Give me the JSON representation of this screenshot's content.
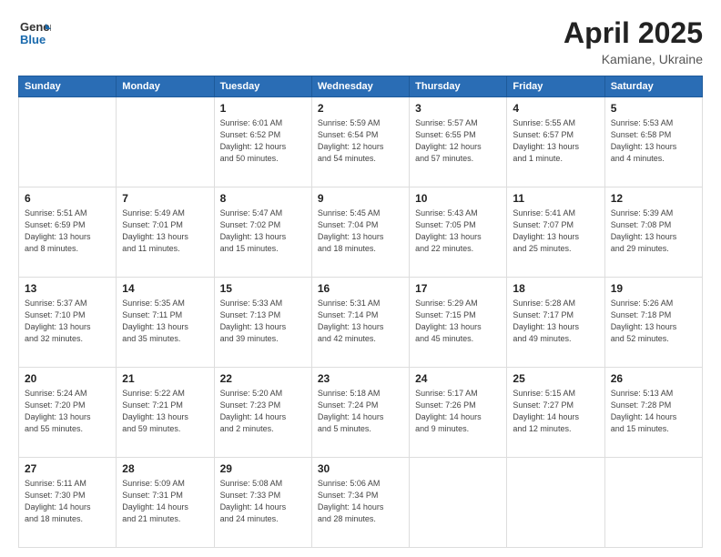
{
  "header": {
    "logo_general": "General",
    "logo_blue": "Blue",
    "title": "April 2025",
    "location": "Kamiane, Ukraine"
  },
  "weekdays": [
    "Sunday",
    "Monday",
    "Tuesday",
    "Wednesday",
    "Thursday",
    "Friday",
    "Saturday"
  ],
  "rows": [
    [
      {
        "day": "",
        "info": ""
      },
      {
        "day": "",
        "info": ""
      },
      {
        "day": "1",
        "info": "Sunrise: 6:01 AM\nSunset: 6:52 PM\nDaylight: 12 hours\nand 50 minutes."
      },
      {
        "day": "2",
        "info": "Sunrise: 5:59 AM\nSunset: 6:54 PM\nDaylight: 12 hours\nand 54 minutes."
      },
      {
        "day": "3",
        "info": "Sunrise: 5:57 AM\nSunset: 6:55 PM\nDaylight: 12 hours\nand 57 minutes."
      },
      {
        "day": "4",
        "info": "Sunrise: 5:55 AM\nSunset: 6:57 PM\nDaylight: 13 hours\nand 1 minute."
      },
      {
        "day": "5",
        "info": "Sunrise: 5:53 AM\nSunset: 6:58 PM\nDaylight: 13 hours\nand 4 minutes."
      }
    ],
    [
      {
        "day": "6",
        "info": "Sunrise: 5:51 AM\nSunset: 6:59 PM\nDaylight: 13 hours\nand 8 minutes."
      },
      {
        "day": "7",
        "info": "Sunrise: 5:49 AM\nSunset: 7:01 PM\nDaylight: 13 hours\nand 11 minutes."
      },
      {
        "day": "8",
        "info": "Sunrise: 5:47 AM\nSunset: 7:02 PM\nDaylight: 13 hours\nand 15 minutes."
      },
      {
        "day": "9",
        "info": "Sunrise: 5:45 AM\nSunset: 7:04 PM\nDaylight: 13 hours\nand 18 minutes."
      },
      {
        "day": "10",
        "info": "Sunrise: 5:43 AM\nSunset: 7:05 PM\nDaylight: 13 hours\nand 22 minutes."
      },
      {
        "day": "11",
        "info": "Sunrise: 5:41 AM\nSunset: 7:07 PM\nDaylight: 13 hours\nand 25 minutes."
      },
      {
        "day": "12",
        "info": "Sunrise: 5:39 AM\nSunset: 7:08 PM\nDaylight: 13 hours\nand 29 minutes."
      }
    ],
    [
      {
        "day": "13",
        "info": "Sunrise: 5:37 AM\nSunset: 7:10 PM\nDaylight: 13 hours\nand 32 minutes."
      },
      {
        "day": "14",
        "info": "Sunrise: 5:35 AM\nSunset: 7:11 PM\nDaylight: 13 hours\nand 35 minutes."
      },
      {
        "day": "15",
        "info": "Sunrise: 5:33 AM\nSunset: 7:13 PM\nDaylight: 13 hours\nand 39 minutes."
      },
      {
        "day": "16",
        "info": "Sunrise: 5:31 AM\nSunset: 7:14 PM\nDaylight: 13 hours\nand 42 minutes."
      },
      {
        "day": "17",
        "info": "Sunrise: 5:29 AM\nSunset: 7:15 PM\nDaylight: 13 hours\nand 45 minutes."
      },
      {
        "day": "18",
        "info": "Sunrise: 5:28 AM\nSunset: 7:17 PM\nDaylight: 13 hours\nand 49 minutes."
      },
      {
        "day": "19",
        "info": "Sunrise: 5:26 AM\nSunset: 7:18 PM\nDaylight: 13 hours\nand 52 minutes."
      }
    ],
    [
      {
        "day": "20",
        "info": "Sunrise: 5:24 AM\nSunset: 7:20 PM\nDaylight: 13 hours\nand 55 minutes."
      },
      {
        "day": "21",
        "info": "Sunrise: 5:22 AM\nSunset: 7:21 PM\nDaylight: 13 hours\nand 59 minutes."
      },
      {
        "day": "22",
        "info": "Sunrise: 5:20 AM\nSunset: 7:23 PM\nDaylight: 14 hours\nand 2 minutes."
      },
      {
        "day": "23",
        "info": "Sunrise: 5:18 AM\nSunset: 7:24 PM\nDaylight: 14 hours\nand 5 minutes."
      },
      {
        "day": "24",
        "info": "Sunrise: 5:17 AM\nSunset: 7:26 PM\nDaylight: 14 hours\nand 9 minutes."
      },
      {
        "day": "25",
        "info": "Sunrise: 5:15 AM\nSunset: 7:27 PM\nDaylight: 14 hours\nand 12 minutes."
      },
      {
        "day": "26",
        "info": "Sunrise: 5:13 AM\nSunset: 7:28 PM\nDaylight: 14 hours\nand 15 minutes."
      }
    ],
    [
      {
        "day": "27",
        "info": "Sunrise: 5:11 AM\nSunset: 7:30 PM\nDaylight: 14 hours\nand 18 minutes."
      },
      {
        "day": "28",
        "info": "Sunrise: 5:09 AM\nSunset: 7:31 PM\nDaylight: 14 hours\nand 21 minutes."
      },
      {
        "day": "29",
        "info": "Sunrise: 5:08 AM\nSunset: 7:33 PM\nDaylight: 14 hours\nand 24 minutes."
      },
      {
        "day": "30",
        "info": "Sunrise: 5:06 AM\nSunset: 7:34 PM\nDaylight: 14 hours\nand 28 minutes."
      },
      {
        "day": "",
        "info": ""
      },
      {
        "day": "",
        "info": ""
      },
      {
        "day": "",
        "info": ""
      }
    ]
  ]
}
